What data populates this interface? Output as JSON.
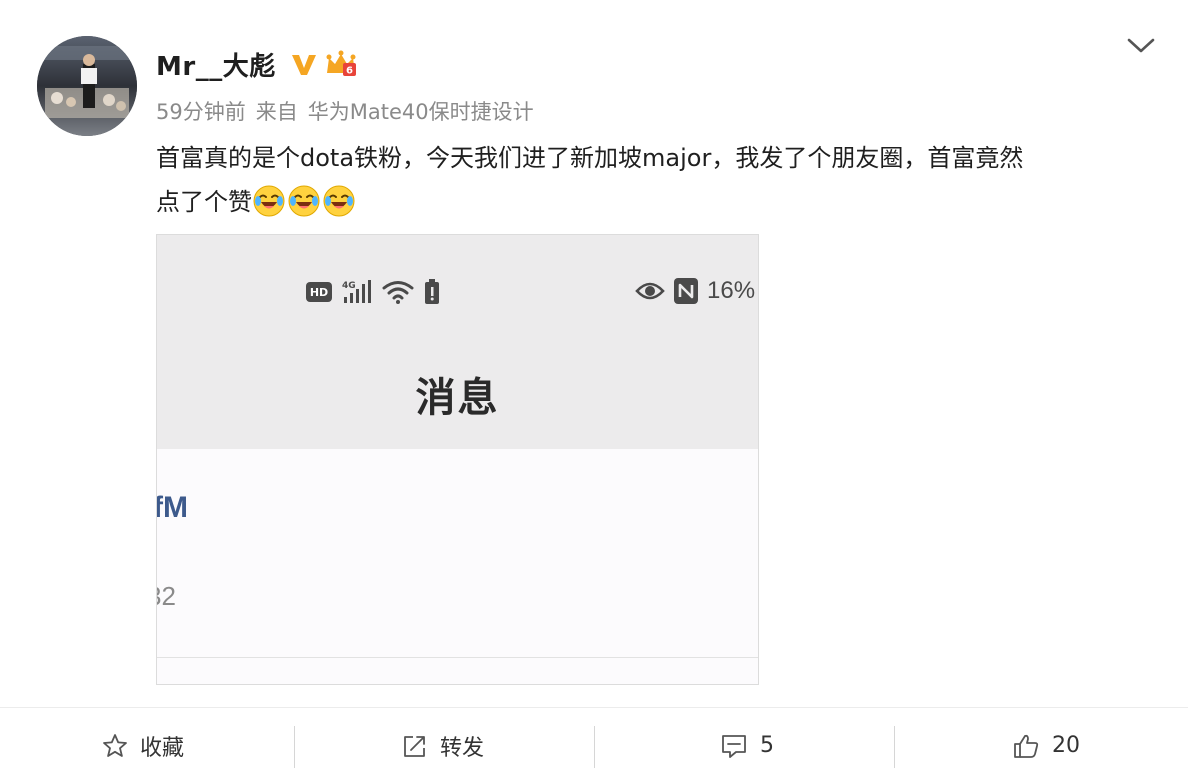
{
  "post": {
    "username": "Mr__大彪",
    "time": "59分钟前",
    "source_prefix": "来自",
    "source_device": "华为Mate40保时捷设计",
    "content_line1": "首富真的是个dota铁粉，今天我们进了新加坡major，我发了个朋友圈，首富竟然",
    "content_line2": "点了个赞",
    "emoji_name": "laugh-cry-emoji",
    "emoji_count": 3,
    "badges": [
      "verified-v-icon",
      "crown-level-icon"
    ],
    "accent_color": "#f5a623"
  },
  "attachment": {
    "status_bar": {
      "hd_label": "HD",
      "network_label": "4G",
      "battery_percent": "16%",
      "icons": [
        "signal-icon",
        "wifi-icon",
        "battery-icon",
        "eye-icon",
        "nfc-icon"
      ]
    },
    "title": "消息",
    "fragment_name": "fM",
    "fragment_number": "32"
  },
  "actions": {
    "favorite_label": "收藏",
    "repost_label": "转发",
    "comment_count": "5",
    "like_count": "20"
  }
}
